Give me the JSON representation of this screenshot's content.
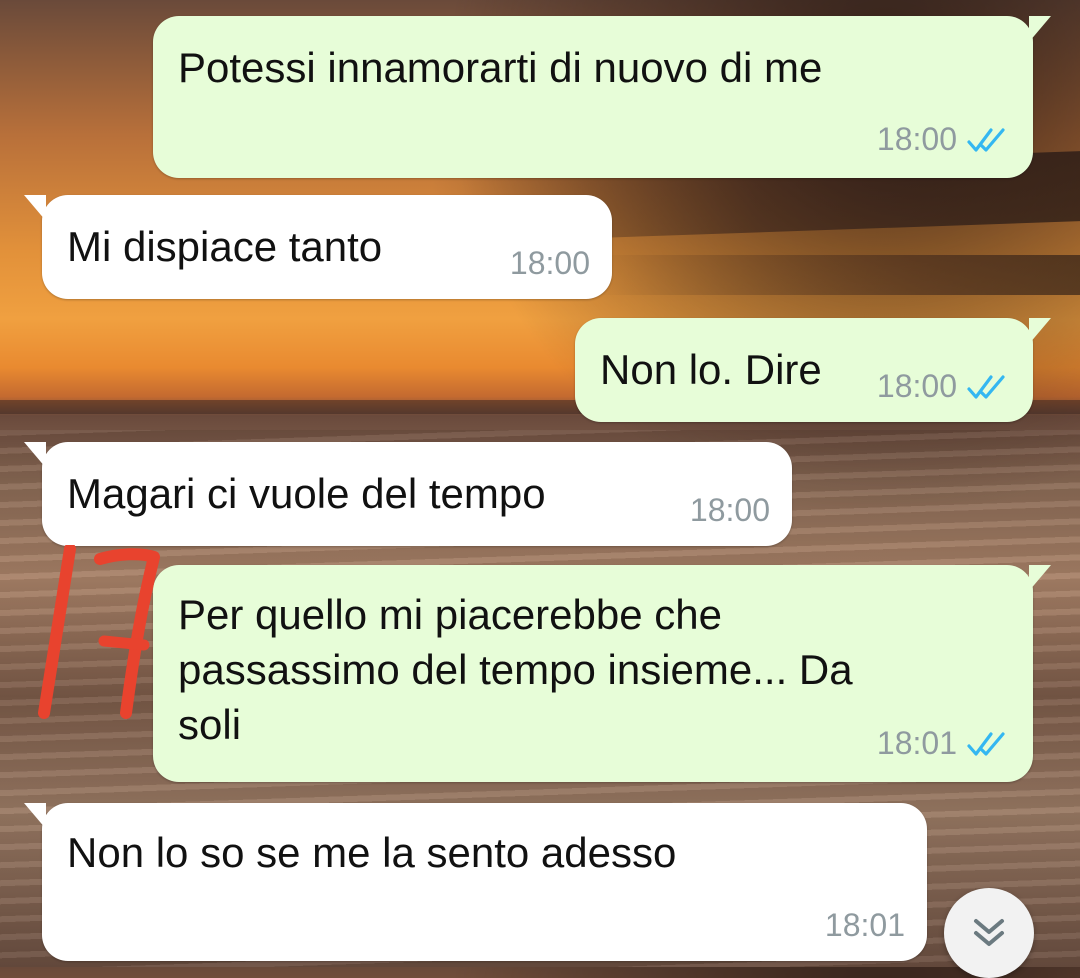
{
  "colors": {
    "outgoing_bubble": "#e7fdd8",
    "incoming_bubble": "#ffffff",
    "read_ticks": "#34b7f1",
    "annotation": "#e8432e"
  },
  "messages": [
    {
      "direction": "outgoing",
      "text": "Potessi innamorarti di nuovo di me",
      "time": "18:00",
      "status": "read"
    },
    {
      "direction": "incoming",
      "text": "Mi dispiace tanto",
      "time": "18:00"
    },
    {
      "direction": "outgoing",
      "text": "Non lo. Dire",
      "time": "18:00",
      "status": "read"
    },
    {
      "direction": "incoming",
      "text": "Magari ci vuole del tempo",
      "time": "18:00"
    },
    {
      "direction": "outgoing",
      "text": "Per quello mi piacerebbe che\npassassimo del tempo insieme... Da\nsoli",
      "time": "18:01",
      "status": "read"
    },
    {
      "direction": "incoming",
      "text": "Non lo so se me la sento adesso",
      "time": "18:01"
    }
  ],
  "annotation": {
    "kind": "handwritten-mark",
    "text": "17"
  },
  "scroll_button": {
    "icon": "double-chevron-down-icon"
  },
  "icons": {
    "read_receipt": "double-check-icon"
  }
}
